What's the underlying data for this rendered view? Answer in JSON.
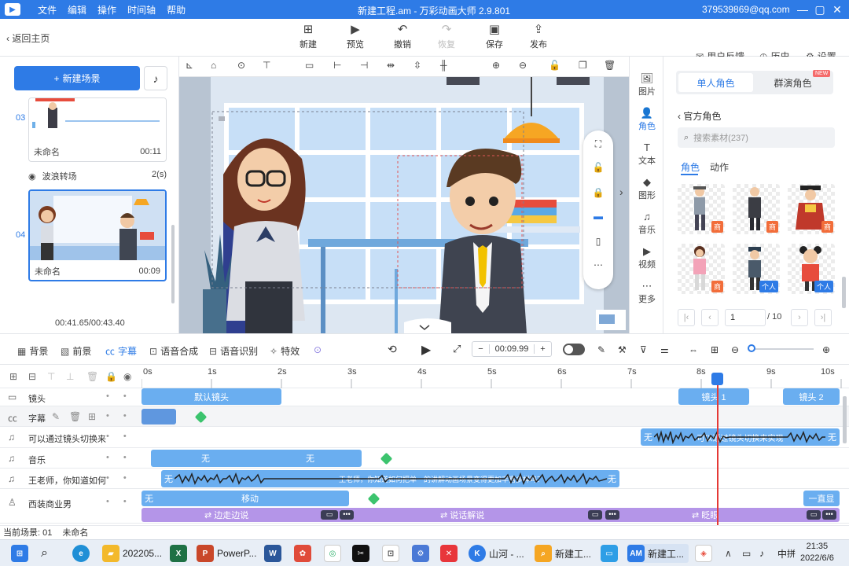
{
  "titlebar": {
    "menus": [
      "文件",
      "编辑",
      "操作",
      "时间轴",
      "帮助"
    ],
    "title": "新建工程.am - 万彩动画大师 2.9.801",
    "account": "379539869@qq.com"
  },
  "toolbar": {
    "back": "返回主页",
    "new": "新建",
    "preview": "预览",
    "undo": "撤销",
    "redo": "恢复",
    "save": "保存",
    "publish": "发布",
    "feedback": "用户反馈",
    "history": "历史",
    "settings": "设置"
  },
  "scenes": {
    "new_scene": "新建场景",
    "scene3": {
      "num": "03",
      "name": "未命名",
      "time": "00:11"
    },
    "transition": {
      "name": "波浪转场",
      "duration": "2(s)"
    },
    "scene4": {
      "num": "04",
      "name": "未命名",
      "time": "00:09"
    },
    "total_time": "00:41.65/00:43.40"
  },
  "right_tabs": [
    "图片",
    "角色",
    "文本",
    "图形",
    "音乐",
    "视频",
    "更多"
  ],
  "asset_panel": {
    "seg_single": "单人角色",
    "seg_group": "群演角色",
    "new_badge": "NEW",
    "breadcrumb": "官方角色",
    "search_placeholder": "搜索素材(237)",
    "subtab_role": "角色",
    "subtab_action": "动作",
    "tags": [
      "商",
      "商",
      "商",
      "商",
      "个人",
      "个人"
    ],
    "page_current": "1",
    "page_total": "/ 10"
  },
  "timeline_tools": {
    "background": "背景",
    "foreground": "前景",
    "subtitle": "字幕",
    "tts": "语音合成",
    "asr": "语音识别",
    "effects": "特效",
    "current_time": "00:09.99",
    "minus": "−",
    "plus": "+"
  },
  "ruler": [
    "0s",
    "1s",
    "2s",
    "3s",
    "4s",
    "5s",
    "6s",
    "7s",
    "8s",
    "9s",
    "10s"
  ],
  "tracks": [
    {
      "name": "镜头",
      "bars": [
        "默认镜头",
        "镜头 1",
        "镜头 2"
      ]
    },
    {
      "name": "字幕",
      "bars": []
    },
    {
      "name": "可以通过镜头切换来",
      "bars": [
        "无",
        "可以通过镜头切换来实现",
        "无"
      ]
    },
    {
      "name": "音乐",
      "bars": [
        "无",
        "无"
      ]
    },
    {
      "name": "王老师，你知道如何",
      "bars": [
        "无",
        "王老师，你知道如何把单一的讲解动画场景变得更加丰富多样吗？",
        "无"
      ]
    },
    {
      "name": "西装商业男",
      "bars": [
        "无",
        "移动",
        "一直显",
        "⇄ 边走边说",
        "⇄ 说话解说",
        "⇄ 眨眼"
      ]
    }
  ],
  "status_bar": {
    "current_scene": "当前场景: 01",
    "scene_name": "未命名"
  },
  "taskbar": {
    "items": [
      "202205...",
      "PowerP...",
      "山河 - ...",
      "新建工...",
      "新建工..."
    ],
    "ime": "中",
    "ime2": "拼",
    "time": "21:35",
    "date": "2022/6/6"
  },
  "colors": {
    "accent": "#2e7be6",
    "playhead": "#e53935",
    "keyframe": "#3cc46e"
  }
}
